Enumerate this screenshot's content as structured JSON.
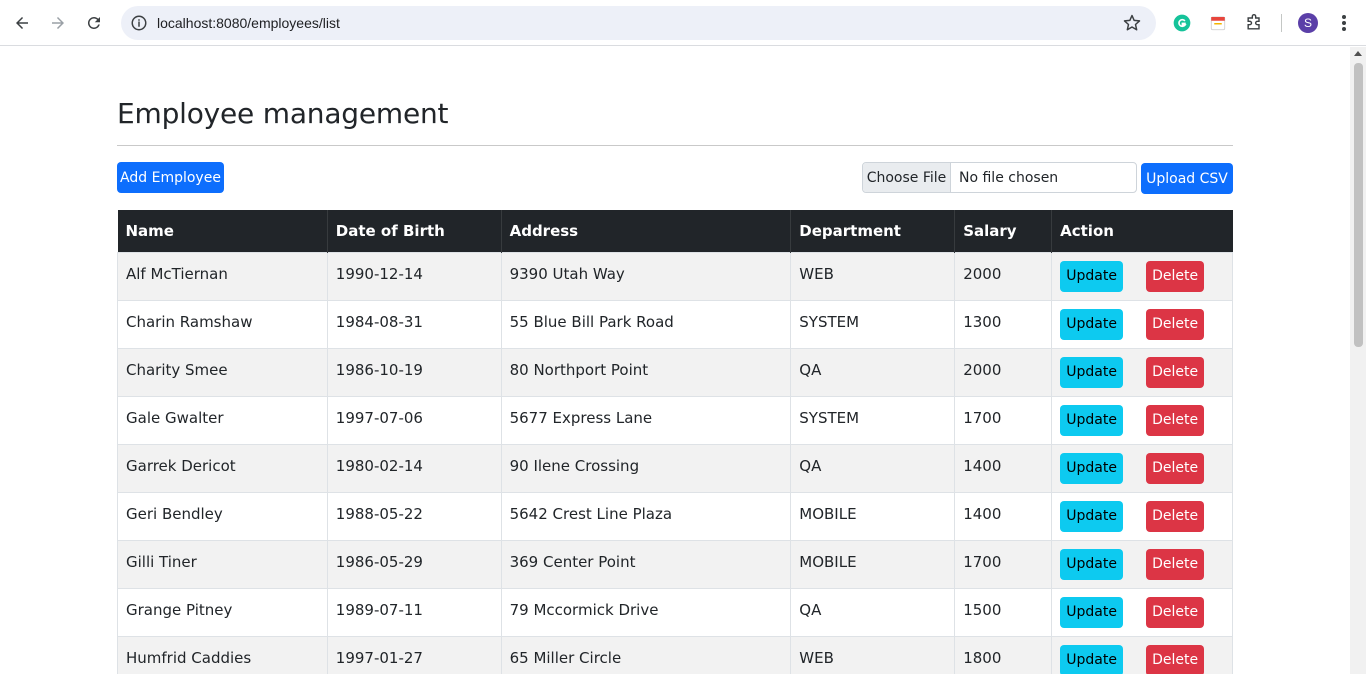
{
  "browser": {
    "url": "localhost:8080/employees/list",
    "avatar_letter": "S"
  },
  "page": {
    "title": "Employee management",
    "add_label": "Add Employee",
    "choose_file_label": "Choose File",
    "no_file_label": "No file chosen",
    "upload_label": "Upload CSV"
  },
  "table": {
    "headers": [
      "Name",
      "Date of Birth",
      "Address",
      "Department",
      "Salary",
      "Action"
    ],
    "update_label": "Update",
    "delete_label": "Delete",
    "rows": [
      {
        "name": "Alf McTiernan",
        "dob": "1990-12-14",
        "address": "9390 Utah Way",
        "department": "WEB",
        "salary": "2000"
      },
      {
        "name": "Charin Ramshaw",
        "dob": "1984-08-31",
        "address": "55 Blue Bill Park Road",
        "department": "SYSTEM",
        "salary": "1300"
      },
      {
        "name": "Charity Smee",
        "dob": "1986-10-19",
        "address": "80 Northport Point",
        "department": "QA",
        "salary": "2000"
      },
      {
        "name": "Gale Gwalter",
        "dob": "1997-07-06",
        "address": "5677 Express Lane",
        "department": "SYSTEM",
        "salary": "1700"
      },
      {
        "name": "Garrek Dericot",
        "dob": "1980-02-14",
        "address": "90 Ilene Crossing",
        "department": "QA",
        "salary": "1400"
      },
      {
        "name": "Geri Bendley",
        "dob": "1988-05-22",
        "address": "5642 Crest Line Plaza",
        "department": "MOBILE",
        "salary": "1400"
      },
      {
        "name": "Gilli Tiner",
        "dob": "1986-05-29",
        "address": "369 Center Point",
        "department": "MOBILE",
        "salary": "1700"
      },
      {
        "name": "Grange Pitney",
        "dob": "1989-07-11",
        "address": "79 Mccormick Drive",
        "department": "QA",
        "salary": "1500"
      },
      {
        "name": "Humfrid Caddies",
        "dob": "1997-01-27",
        "address": "65 Miller Circle",
        "department": "WEB",
        "salary": "1800"
      }
    ]
  },
  "colors": {
    "primary": "#0d6efd",
    "info": "#0dcaf0",
    "danger": "#dc3545",
    "dark": "#212529"
  }
}
